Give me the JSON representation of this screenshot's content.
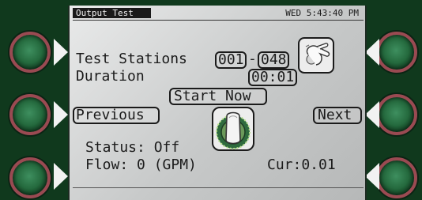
{
  "header": {
    "title": "Output Test",
    "clock": "WED 5:43:40 PM"
  },
  "test_stations": {
    "label": "Test Stations",
    "start": "001",
    "separator": "-",
    "end": "048"
  },
  "duration": {
    "label": "Duration",
    "value": "00:01"
  },
  "actions": {
    "start_now": "Start Now",
    "previous": "Previous",
    "next": "Next"
  },
  "status": {
    "status_text": "Status: Off",
    "flow_text": "Flow: 0 (GPM)",
    "current_text": "Cur:0.01"
  },
  "icons": {
    "hand_turning_knob": "hand-turning-knob-icon",
    "press_dial": "finger-press-dial-icon",
    "side_buttons": "hardware-arrow-button"
  },
  "colors": {
    "bezel": "#10391d",
    "button_ring": "#9a4a52",
    "button_face": "#24693d",
    "text": "#1b1b1b"
  }
}
